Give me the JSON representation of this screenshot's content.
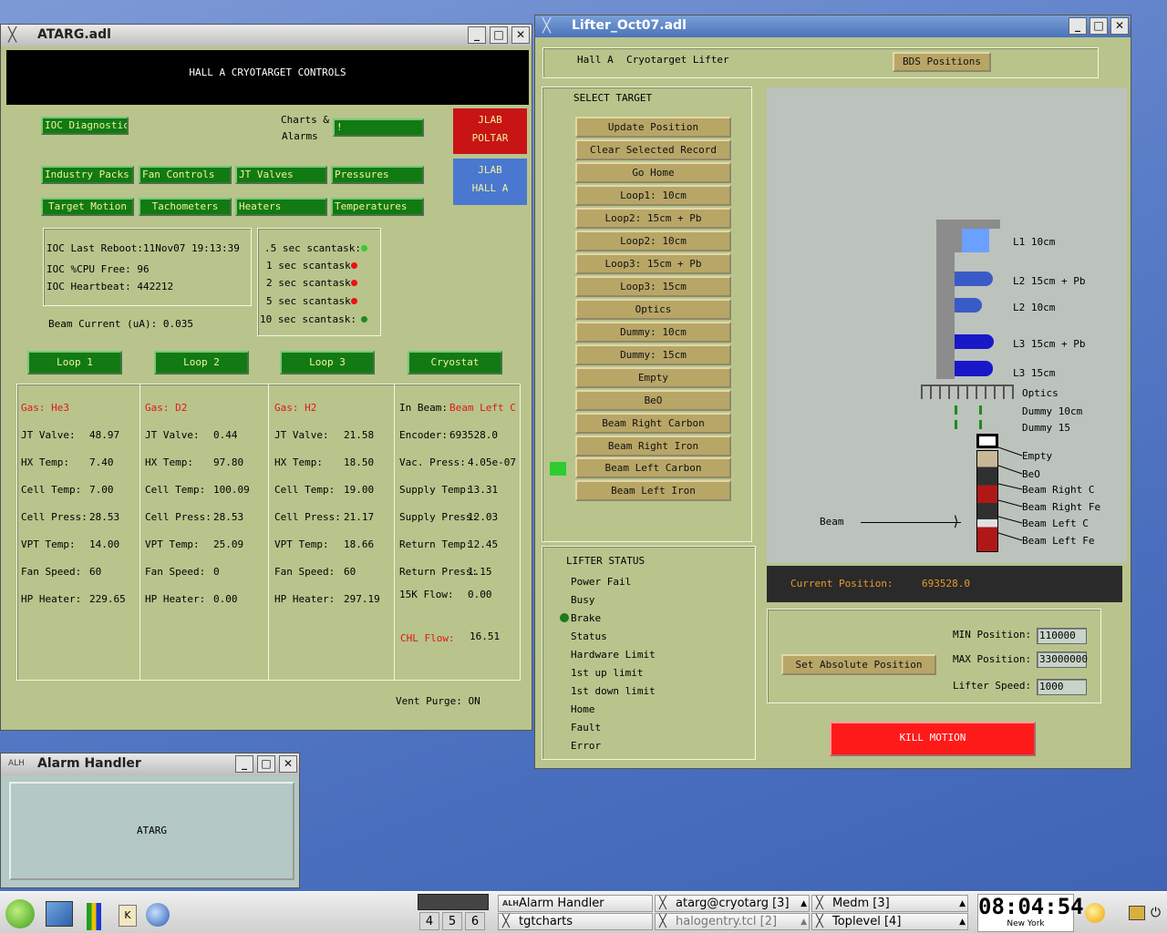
{
  "atarg_window": {
    "title": "ATARG.adl",
    "banner": "HALL A CRYOTARGET CONTROLS",
    "ioc_diagnostics": "IOC Diagnostics",
    "charts_label_1": "Charts &",
    "charts_label_2": "Alarms",
    "charts_button": "!",
    "jlab_poltar": [
      "JLAB",
      "POLTAR"
    ],
    "jlab_halla": [
      "JLAB",
      "HALL A"
    ],
    "nav_row1": [
      "Industry Packs",
      "Fan Controls",
      "JT Valves",
      "Pressures"
    ],
    "nav_row2": [
      "Target Motion",
      "Tachometers",
      "Heaters",
      "Temperatures"
    ],
    "ioc_reboot": "IOC Last Reboot:11Nov07 19:13:39",
    "ioc_cpu": "IOC %CPU Free:  96",
    "ioc_heartbeat": "IOC Heartbeat:  442212",
    "beam_current": "Beam Current (uA): 0.035",
    "scantasks": [
      ".5 sec scantask:",
      "1 sec scantask:",
      "2 sec scantask:",
      "5 sec scantask:",
      "10 sec scantask:"
    ],
    "scantask_colors": [
      "#33cc33",
      "#ee1111",
      "#ee1111",
      "#ee1111",
      "#228822"
    ],
    "loops": [
      "Loop 1",
      "Loop 2",
      "Loop 3",
      "Cryostat"
    ],
    "loop_data": [
      {
        "gas": "Gas: He3",
        "rows": [
          [
            "JT Valve:",
            "48.97"
          ],
          [
            "HX Temp:",
            "7.40"
          ],
          [
            "Cell Temp:",
            "7.00"
          ],
          [
            "Cell Press:",
            "28.53"
          ],
          [
            "VPT Temp:",
            "14.00"
          ],
          [
            "Fan Speed:",
            "60"
          ],
          [
            "HP Heater:",
            "229.65"
          ]
        ]
      },
      {
        "gas": "Gas: D2",
        "rows": [
          [
            "JT Valve:",
            "0.44"
          ],
          [
            "HX Temp:",
            "97.80"
          ],
          [
            "Cell Temp:",
            "100.09"
          ],
          [
            "Cell Press:",
            "28.53"
          ],
          [
            "VPT Temp:",
            "25.09"
          ],
          [
            "Fan Speed:",
            "0"
          ],
          [
            "HP Heater:",
            "0.00"
          ]
        ]
      },
      {
        "gas": "Gas: H2",
        "rows": [
          [
            "JT Valve:",
            "21.58"
          ],
          [
            "HX Temp:",
            "18.50"
          ],
          [
            "Cell Temp:",
            "19.00"
          ],
          [
            "Cell Press:",
            "21.17"
          ],
          [
            "VPT Temp:",
            "18.66"
          ],
          [
            "Fan Speed:",
            "60"
          ],
          [
            "HP Heater:",
            "297.19"
          ]
        ]
      }
    ],
    "cryostat": {
      "in_beam_label": "In Beam:",
      "in_beam_value": "Beam Left C",
      "rows": [
        [
          "Encoder:",
          "693528.0"
        ],
        [
          "Vac. Press:",
          "4.05e-07"
        ],
        [
          "Supply Temp:",
          "13.31"
        ],
        [
          "Supply Press:",
          "12.03"
        ],
        [
          "Return Temp:",
          "12.45"
        ],
        [
          "Return Press:",
          "1.15"
        ],
        [
          "15K Flow:",
          "0.00"
        ]
      ],
      "chl_label": "CHL Flow:",
      "chl_value": "16.51"
    },
    "vent_purge": "Vent Purge:  ON"
  },
  "lifter_window": {
    "title": "Lifter_Oct07.adl",
    "header_hall": "Hall A",
    "header_name": "Cryotarget Lifter",
    "bds_button": "BDS Positions",
    "select_target": "SELECT TARGET",
    "targets": [
      "Update Position",
      "Clear Selected Record",
      "Go Home",
      "Loop1: 10cm",
      "Loop2: 15cm + Pb",
      "Loop2: 10cm",
      "Loop3: 15cm + Pb",
      "Loop3: 15cm",
      "Optics",
      "Dummy: 10cm",
      "Dummy: 15cm",
      "Empty",
      "BeO",
      "Beam Right Carbon",
      "Beam Right Iron",
      "Beam Left Carbon",
      "Beam Left Iron"
    ],
    "diagram_labels": [
      "L1 10cm",
      "L2 15cm + Pb",
      "L2 10cm",
      "L3 15cm + Pb",
      "L3 15cm",
      "Optics",
      "Dummy 10cm",
      "Dummy 15",
      "Empty",
      "BeO",
      "Beam Right C",
      "Beam Right Fe",
      "Beam Left C",
      "Beam Left Fe"
    ],
    "beam_label": "Beam",
    "current_position_label": "Current Position:",
    "current_position_value": "693528.0",
    "lifter_status_title": "LIFTER STATUS",
    "lifter_status": [
      "Power Fail",
      "Busy",
      "Brake",
      "Status",
      "Hardware Limit",
      "1st up limit",
      "1st down limit",
      "Home",
      "Fault",
      "Error"
    ],
    "set_abs_button": "Set Absolute Position",
    "min_label": "MIN Position:",
    "min_value": "110000",
    "max_label": "MAX Position:",
    "max_value": "33000000",
    "speed_label": "Lifter Speed:",
    "speed_value": "1000",
    "kill_button": "KILL MOTION"
  },
  "alarm_window": {
    "title": "Alarm Handler",
    "group": "ATARG"
  },
  "taskbar": {
    "pager": [
      "4",
      "5",
      "6"
    ],
    "tasks": [
      "Alarm Handler",
      "atarg@cryotarg [3]",
      "Medm [3]",
      "tgtcharts",
      "halogentry.tcl [2]",
      "Toplevel [4]"
    ],
    "clock": "08:04:54",
    "city": "New York"
  },
  "colors": {
    "panel": "#b8c48c",
    "green_button": "#127a12",
    "tan_button": "#b8a667",
    "alarm_red": "#e01818",
    "kill_red": "#ff1a1a",
    "jlab_red": "#c81414",
    "jlab_blue": "#4a78d0"
  }
}
